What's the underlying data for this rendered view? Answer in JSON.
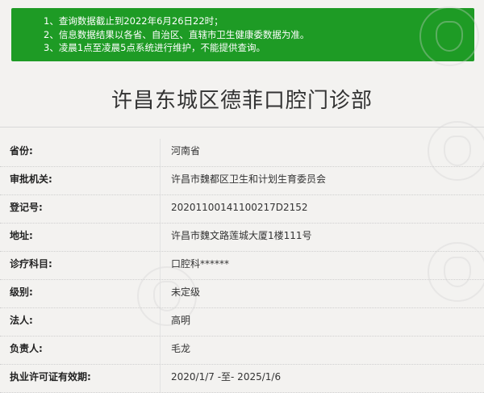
{
  "notice": {
    "lines": [
      "1、查询数据截止到2022年6月26日22时；",
      "2、信息数据结果以各省、自治区、直辖市卫生健康委数据为准。",
      "3、凌晨1点至凌晨5点系统进行维护，不能提供查询。"
    ]
  },
  "page_title": "许昌东城区德菲口腔门诊部",
  "records": [
    {
      "label": "省份:",
      "value": "河南省"
    },
    {
      "label": "审批机关:",
      "value": "许昌市魏都区卫生和计划生育委员会"
    },
    {
      "label": "登记号:",
      "value": "20201100141100217D2152"
    },
    {
      "label": "地址:",
      "value": "许昌市魏文路莲城大厦1楼111号"
    },
    {
      "label": "诊疗科目:",
      "value": "口腔科******"
    },
    {
      "label": "级别:",
      "value": "未定级"
    },
    {
      "label": "法人:",
      "value": "高明"
    },
    {
      "label": "负责人:",
      "value": "毛龙"
    },
    {
      "label": "执业许可证有效期:",
      "value": "2020/1/7 -至- 2025/1/6"
    }
  ],
  "colors": {
    "notice_bg": "#1e9b25",
    "page_bg": "#f3f2f0"
  }
}
